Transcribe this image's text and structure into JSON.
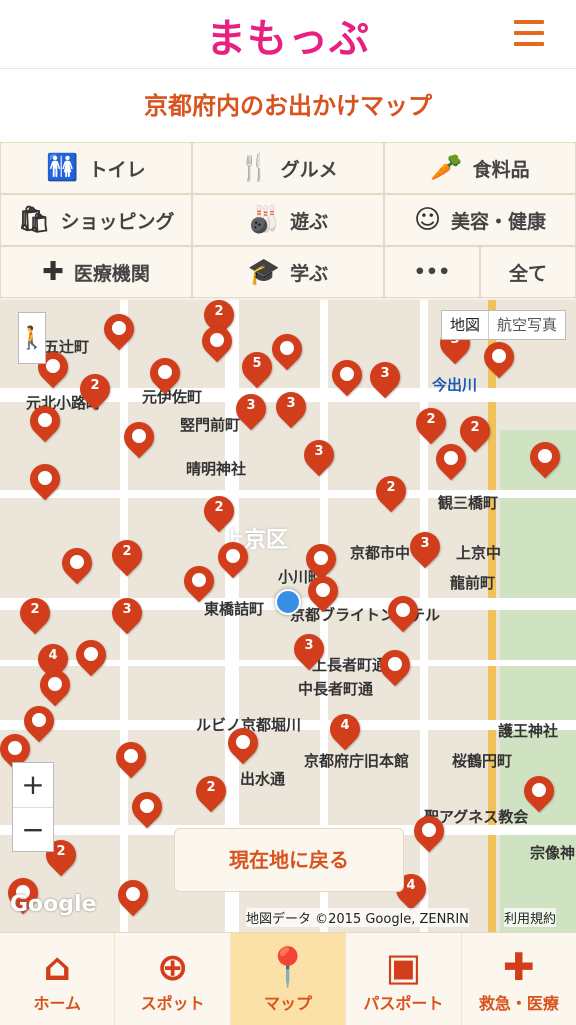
{
  "header": {
    "logo": "まもっぷ",
    "title": "京都府内のお出かけマップ"
  },
  "categories": [
    {
      "label": "トイレ",
      "icon": "toilet-icon"
    },
    {
      "label": "グルメ",
      "icon": "fork-knife-icon"
    },
    {
      "label": "食料品",
      "icon": "carrot-icon"
    },
    {
      "label": "ショッピング",
      "icon": "shopping-icon"
    },
    {
      "label": "遊ぶ",
      "icon": "bowling-icon"
    },
    {
      "label": "美容・健康",
      "icon": "face-icon"
    },
    {
      "label": "医療機関",
      "icon": "medical-cross-icon"
    },
    {
      "label": "学ぶ",
      "icon": "graduation-cap-icon"
    },
    {
      "label": "•••",
      "icon": "more-icon"
    },
    {
      "label": "全て",
      "icon": ""
    }
  ],
  "map": {
    "maptype": {
      "map": "地図",
      "satellite": "航空写真"
    },
    "labels": [
      "五辻町",
      "元北小路町",
      "元伊佐町",
      "竪門前町",
      "晴明神社",
      "上京区",
      "小川町",
      "東橋詰町",
      "京都ブライトンホテル",
      "京都市中",
      "上京中",
      "龍前町",
      "観三橋町",
      "今出川",
      "桜鶴円町",
      "護王神社",
      "聖アグネス教会",
      "京都府庁旧本館",
      "出水通",
      "ルビノ京都堀川",
      "中長者町通",
      "上長者町通",
      "宗像神"
    ],
    "back_button": "現在地に戻る",
    "attribution": "地図データ ©2015 Google, ZENRIN",
    "terms": "利用規約",
    "google": "Google",
    "zoom_in": "+",
    "zoom_out": "−",
    "pin_counts": [
      "2",
      "5",
      "3",
      "3",
      "2",
      "3",
      "3",
      "2",
      "3",
      "2",
      "3",
      "2",
      "2",
      "2",
      "4",
      "2",
      "3",
      "3",
      "4"
    ]
  },
  "tabs": [
    {
      "label": "ホーム",
      "icon": "home-icon"
    },
    {
      "label": "スポット",
      "icon": "search-plus-icon"
    },
    {
      "label": "マップ",
      "icon": "map-pin-icon"
    },
    {
      "label": "パスポート",
      "icon": "passport-icon"
    },
    {
      "label": "救急・医療",
      "icon": "emergency-cross-icon"
    }
  ]
}
